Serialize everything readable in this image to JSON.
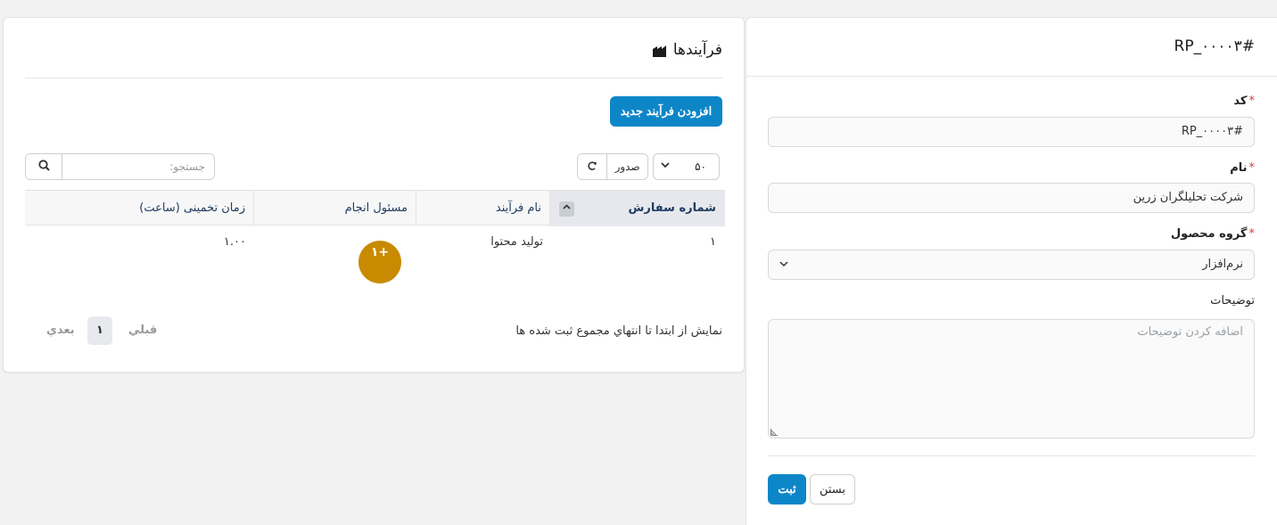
{
  "form": {
    "title": "RP_۰۰۰۰۳#",
    "code_label": "کد",
    "code_value": "RP_۰۰۰۰۳#",
    "name_label": "نام",
    "name_value": "شرکت تحلیلگران زرین",
    "group_label": "گروه محصول",
    "group_value": "نرم‌افزار",
    "desc_label": "توضیحات",
    "desc_placeholder": "اضافه کردن توضیحات",
    "required_mark": "*",
    "save_label": "ثبت",
    "close_label": "بستن"
  },
  "card": {
    "title": "فرآیندها",
    "add_button": "افزودن فرآیند جدید",
    "page_size": "۵۰",
    "export_label": "صدور",
    "search_placeholder": "جستجو:",
    "columns": [
      "شماره سفارش",
      "نام فرآیند",
      "مسئول انجام",
      "زمان تخمینی (ساعت)"
    ],
    "rows": [
      {
        "order": "۱",
        "process": "تولید محتوا",
        "assignee_avatar": "۱+",
        "estimate": "۱.۰۰"
      }
    ],
    "info_text": "نمایش از ابتدا تا انتهاي مجموع ثبت شده ها",
    "pager": {
      "prev": "قبلي",
      "current": "۱",
      "next": "بعدي"
    }
  },
  "colors": {
    "primary": "#0d86c8",
    "avatar": "#c88a00",
    "required": "#dc3545"
  }
}
